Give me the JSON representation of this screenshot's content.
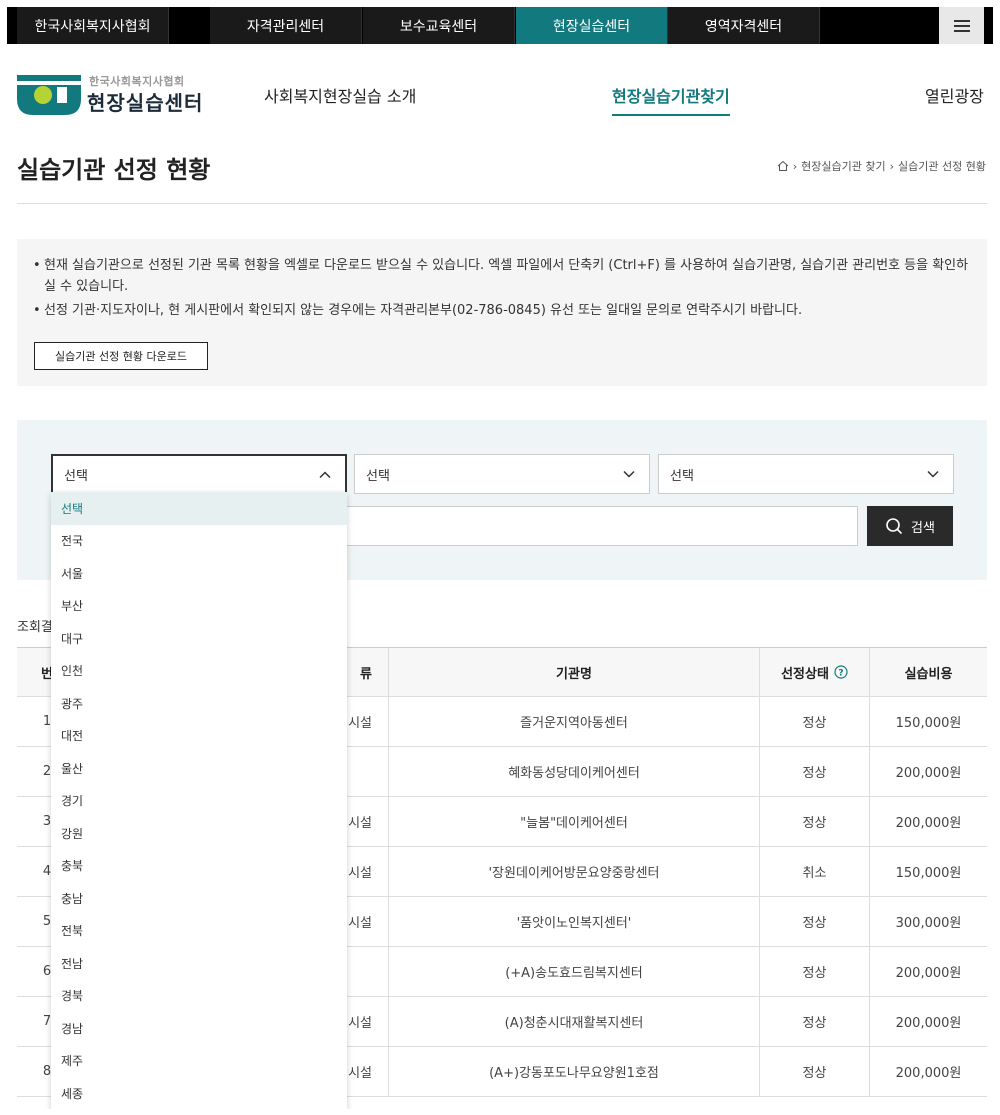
{
  "topbar": {
    "tabs": [
      {
        "label": "한국사회복지사협회"
      },
      {
        "label": "자격관리센터"
      },
      {
        "label": "보수교육센터"
      },
      {
        "label": "현장실습센터"
      },
      {
        "label": "영역자격센터"
      }
    ]
  },
  "header": {
    "logo_sub": "한국사회복지사협회",
    "logo_main": "현장실습센터",
    "nav": [
      {
        "label": "사회복지현장실습 소개"
      },
      {
        "label": "현장실습기관찾기"
      },
      {
        "label": "열린광장"
      }
    ]
  },
  "page": {
    "title": "실습기관 선정 현황",
    "breadcrumb": [
      "현장실습기관 찾기",
      "실습기관 선정 현황"
    ]
  },
  "info": {
    "lines": [
      "현재 실습기관으로 선정된 기관 목록 현황을 엑셀로 다운로드 받으실 수 있습니다. 엑셀 파일에서 단축키 (Ctrl+F) 를 사용하여 실습기관명, 실습기관 관리번호 등을 확인하실 수 있습니다.",
      "선정 기관·지도자이나, 현 게시판에서 확인되지 않는 경우에는 자격관리본부(02-786-0845) 유선 또는 일대일 문의로 연락주시기 바랍니다."
    ],
    "download_label": "실습기관 선정 현황 다운로드"
  },
  "search": {
    "selects": [
      {
        "value": "선택"
      },
      {
        "value": "선택"
      },
      {
        "value": "선택"
      }
    ],
    "search_label": "검색",
    "region_options": [
      "선택",
      "전국",
      "서울",
      "부산",
      "대구",
      "인천",
      "광주",
      "대전",
      "울산",
      "경기",
      "강원",
      "충북",
      "충남",
      "전북",
      "전남",
      "경북",
      "경남",
      "제주",
      "세종"
    ]
  },
  "results": {
    "count_label": "조회결",
    "headers": {
      "no": "번",
      "type": "류",
      "name": "기관명",
      "status": "선정상태",
      "cost": "실습비용"
    },
    "rows": [
      {
        "no": "1",
        "type": "시설",
        "name": "즐거운지역아동센터",
        "status": "정상",
        "cost": "150,000원"
      },
      {
        "no": "2",
        "type": "",
        "name": "혜화동성당데이케어센터",
        "status": "정상",
        "cost": "200,000원"
      },
      {
        "no": "3",
        "type": "시설",
        "name": "\"늘봄\"데이케어센터",
        "status": "정상",
        "cost": "200,000원"
      },
      {
        "no": "4",
        "type": "시설",
        "name": "'장원데이케어방문요양중랑센터",
        "status": "취소",
        "cost": "150,000원"
      },
      {
        "no": "5",
        "type": "시설",
        "name": "'품앗이노인복지센터'",
        "status": "정상",
        "cost": "300,000원"
      },
      {
        "no": "6",
        "type": "",
        "name": "(+A)송도효드림복지센터",
        "status": "정상",
        "cost": "200,000원"
      },
      {
        "no": "7",
        "type": "시설",
        "name": "(A)청춘시대재활복지센터",
        "status": "정상",
        "cost": "200,000원"
      },
      {
        "no": "8",
        "type": "시설",
        "name": "(A+)강동포도나무요양원1호점",
        "status": "정상",
        "cost": "200,000원"
      }
    ]
  },
  "colors": {
    "accent": "#127a7f",
    "cancel": "#d62b2b"
  }
}
